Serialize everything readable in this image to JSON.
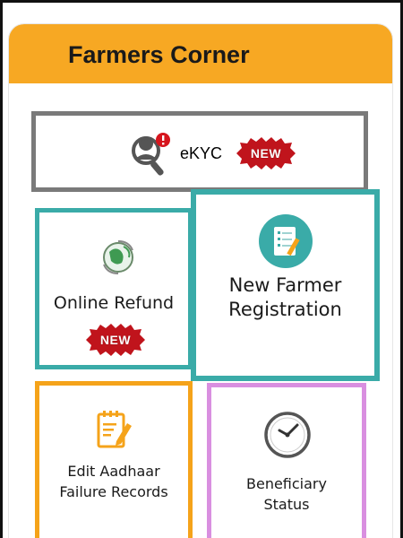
{
  "header": {
    "title": "Farmers Corner"
  },
  "badge_text": "NEW",
  "tiles": {
    "ekyc": {
      "label": "eKYC",
      "icon": "user-search-alert-icon"
    },
    "online_refund": {
      "label": "Online Refund",
      "icon": "refund-globe-icon"
    },
    "new_farmer": {
      "line1": "New Farmer",
      "line2": "Registration",
      "icon": "registration-form-icon"
    },
    "edit_aadhaar": {
      "line1": "Edit Aadhaar",
      "line2": "Failure Records",
      "icon": "edit-document-icon"
    },
    "beneficiary": {
      "line1": "Beneficiary",
      "line2": "Status",
      "icon": "clock-icon"
    }
  },
  "colors": {
    "header": "#f7a823",
    "ekyc_border": "#7a7a7a",
    "teal_border": "#3aaba8",
    "orange_border": "#f5a31a",
    "pink_border": "#d98fe0",
    "badge_red": "#c0141c"
  }
}
